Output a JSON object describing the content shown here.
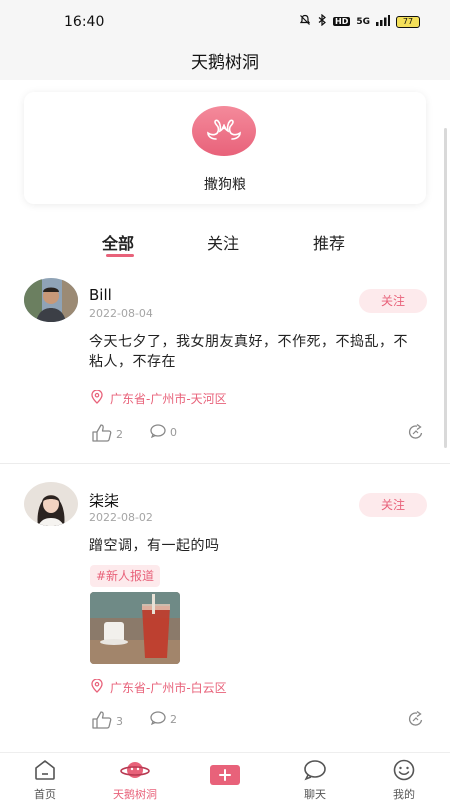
{
  "status": {
    "time": "16:40",
    "network": "5G",
    "hd": "HD",
    "battery": "77"
  },
  "header": {
    "title": "天鹅树洞"
  },
  "feature": {
    "label": "撒狗粮"
  },
  "tabs": [
    {
      "label": "全部",
      "active": true
    },
    {
      "label": "关注",
      "active": false
    },
    {
      "label": "推荐",
      "active": false
    }
  ],
  "posts": [
    {
      "user": "Bill",
      "date": "2022-08-04",
      "follow_label": "关注",
      "text": "今天七夕了，我女朋友真好，不作死，不捣乱，不粘人，不存在",
      "location": "广东省-广州市-天河区",
      "likes": "2",
      "comments": "0"
    },
    {
      "user": "柒柒",
      "date": "2022-08-02",
      "follow_label": "关注",
      "text": "蹭空调，有一起的吗",
      "tag": "#新人报道",
      "location": "广东省-广州市-白云区",
      "likes": "3",
      "comments": "2"
    }
  ],
  "nav": [
    {
      "label": "首页",
      "icon": "home-icon"
    },
    {
      "label": "天鹅树洞",
      "icon": "planet-icon"
    },
    {
      "label": "",
      "icon": "add-icon"
    },
    {
      "label": "聊天",
      "icon": "chat-icon"
    },
    {
      "label": "我的",
      "icon": "smile-icon"
    }
  ],
  "colors": {
    "accent": "#e8627a",
    "accent_light": "#fdeaec",
    "header_bg": "#f6f6f6"
  }
}
